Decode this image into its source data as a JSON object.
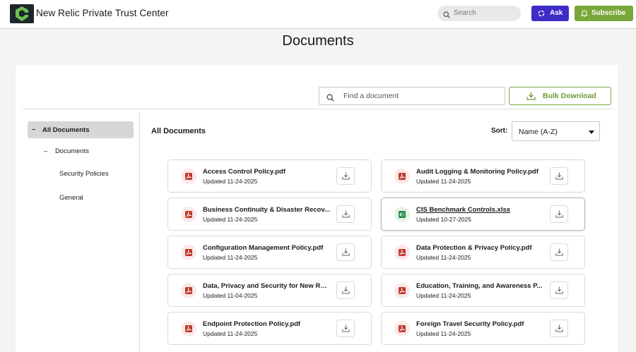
{
  "header": {
    "brand": "New Relic Private Trust Center",
    "search_placeholder": "Search",
    "ask_label": "Ask",
    "subscribe_label": "Subscribe"
  },
  "page": {
    "title": "Documents"
  },
  "toolbar": {
    "find_placeholder": "Find a document",
    "bulk_download_label": "Bulk Download"
  },
  "sidebar": {
    "items": [
      {
        "label": "All Documents",
        "prefix": "–"
      },
      {
        "label": "Documents",
        "prefix": "–"
      },
      {
        "label": "Security Policies"
      },
      {
        "label": "General"
      }
    ]
  },
  "content": {
    "heading": "All Documents",
    "sort_label": "Sort:",
    "sort_value": "Name (A-Z)"
  },
  "documents": [
    {
      "title": "Access Control Policy.pdf",
      "updated": "Updated 11-24-2025",
      "type": "pdf"
    },
    {
      "title": "Audit Logging & Monitoring Policy.pdf",
      "updated": "Updated 11-24-2025",
      "type": "pdf"
    },
    {
      "title": "Business Continuity & Disaster Recov...",
      "updated": "Updated 11-24-2025",
      "type": "pdf"
    },
    {
      "title": "CIS Benchmark Controls.xlsx",
      "updated": "Updated 10-27-2025",
      "type": "xlsx"
    },
    {
      "title": "Configuration Management Policy.pdf",
      "updated": "Updated 11-24-2025",
      "type": "pdf"
    },
    {
      "title": "Data Protection & Privacy Policy.pdf",
      "updated": "Updated 11-24-2025",
      "type": "pdf"
    },
    {
      "title": "Data, Privacy and Security for New Rel...",
      "updated": "Updated 11-04-2025",
      "type": "pdf"
    },
    {
      "title": "Education, Training, and Awareness P...",
      "updated": "Updated 11-24-2025",
      "type": "pdf"
    },
    {
      "title": "Endpoint Protection Policy.pdf",
      "updated": "Updated 11-24-2025",
      "type": "pdf"
    },
    {
      "title": "Foreign Travel Security Policy.pdf",
      "updated": "Updated 11-24-2025",
      "type": "pdf"
    }
  ],
  "colors": {
    "ask": "#3d2cc8",
    "subscribe": "#78a83a",
    "pdf_icon": "#c0392b",
    "xlsx_icon": "#1e7e45"
  },
  "icons": {
    "logo": "new-relic-logo",
    "search": "search-icon",
    "ask": "sparkle-icon",
    "subscribe": "bell-icon",
    "bulk": "download-icon",
    "pdf": "pdf-file-icon",
    "xlsx": "excel-file-icon",
    "download": "download-icon"
  }
}
